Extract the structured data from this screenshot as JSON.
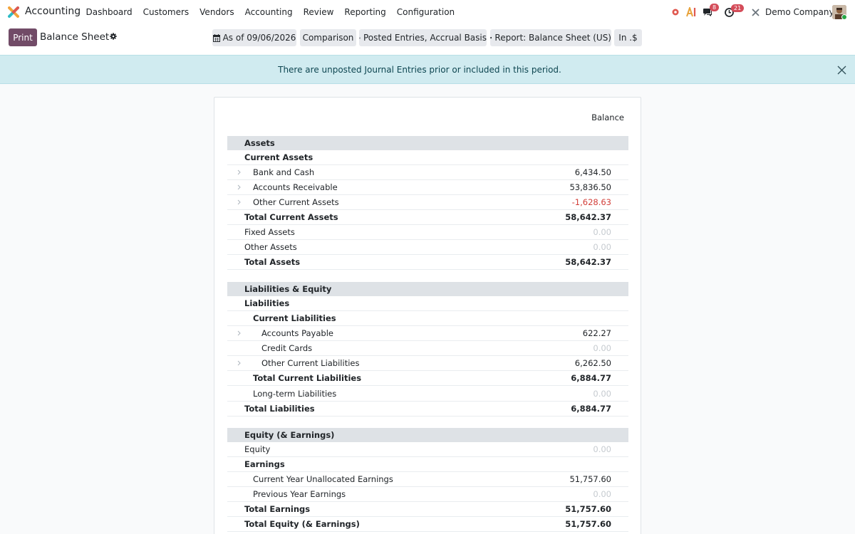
{
  "app": {
    "name": "Accounting"
  },
  "nav": {
    "items": [
      "Dashboard",
      "Customers",
      "Vendors",
      "Accounting",
      "Review",
      "Reporting",
      "Configuration"
    ]
  },
  "systray": {
    "messages_count": "8",
    "activities_count": "21",
    "company": "Demo Company",
    "icons": [
      "record-icon",
      "ai-icon",
      "chat-icon",
      "clock-icon",
      "tools-icon"
    ]
  },
  "control": {
    "print_label": "Print",
    "title": "Balance Sheet",
    "date_filter": "As of 09/06/2026",
    "comparison": "Comparison",
    "entries_filter": "Posted Entries, Accrual Basis",
    "report_variant": "Report: Balance Sheet (US)",
    "currency": "In .$"
  },
  "alert": {
    "text": "There are unposted Journal Entries prior or included in this period."
  },
  "report": {
    "column_header": "Balance",
    "lines": [
      {
        "label": "Assets",
        "value": "",
        "type": "section"
      },
      {
        "label": "Current Assets",
        "value": "",
        "type": "group",
        "level": 1
      },
      {
        "label": "Bank and Cash",
        "value": "6,434.50",
        "type": "line",
        "level": 2,
        "expandable": true
      },
      {
        "label": "Accounts Receivable",
        "value": "53,836.50",
        "type": "line",
        "level": 2,
        "expandable": true
      },
      {
        "label": "Other Current Assets",
        "value": "-1,628.63",
        "type": "line",
        "level": 2,
        "expandable": true,
        "negative": true
      },
      {
        "label": "Total Current Assets",
        "value": "58,642.37",
        "type": "total",
        "level": 1
      },
      {
        "label": "Fixed Assets",
        "value": "0.00",
        "type": "line",
        "level": 1,
        "zero": true
      },
      {
        "label": "Other Assets",
        "value": "0.00",
        "type": "line",
        "level": 1,
        "zero": true
      },
      {
        "label": "Total Assets",
        "value": "58,642.37",
        "type": "total",
        "level": 0
      },
      {
        "label": "Liabilities & Equity",
        "value": "",
        "type": "section"
      },
      {
        "label": "Liabilities",
        "value": "",
        "type": "group",
        "level": 1
      },
      {
        "label": "Current Liabilities",
        "value": "",
        "type": "group",
        "level": 2
      },
      {
        "label": "Accounts Payable",
        "value": "622.27",
        "type": "line",
        "level": 3,
        "expandable": true
      },
      {
        "label": "Credit Cards",
        "value": "0.00",
        "type": "line",
        "level": 3,
        "zero": true
      },
      {
        "label": "Other Current Liabilities",
        "value": "6,262.50",
        "type": "line",
        "level": 3,
        "expandable": true
      },
      {
        "label": "Total Current Liabilities",
        "value": "6,884.77",
        "type": "total",
        "level": 2
      },
      {
        "label": "Long-term Liabilities",
        "value": "0.00",
        "type": "line",
        "level": 2,
        "zero": true
      },
      {
        "label": "Total Liabilities",
        "value": "6,884.77",
        "type": "total",
        "level": 1
      },
      {
        "label": "Equity (& Earnings)",
        "value": "",
        "type": "section"
      },
      {
        "label": "Equity",
        "value": "0.00",
        "type": "line",
        "level": 1,
        "zero": true
      },
      {
        "label": "Earnings",
        "value": "",
        "type": "group",
        "level": 1
      },
      {
        "label": "Current Year Unallocated Earnings",
        "value": "51,757.60",
        "type": "line",
        "level": 2
      },
      {
        "label": "Previous Year Earnings",
        "value": "0.00",
        "type": "line",
        "level": 2,
        "zero": true
      },
      {
        "label": "Total Earnings",
        "value": "51,757.60",
        "type": "total",
        "level": 1
      },
      {
        "label": "Total Equity (& Earnings)",
        "value": "51,757.60",
        "type": "total",
        "level": 0
      }
    ]
  }
}
